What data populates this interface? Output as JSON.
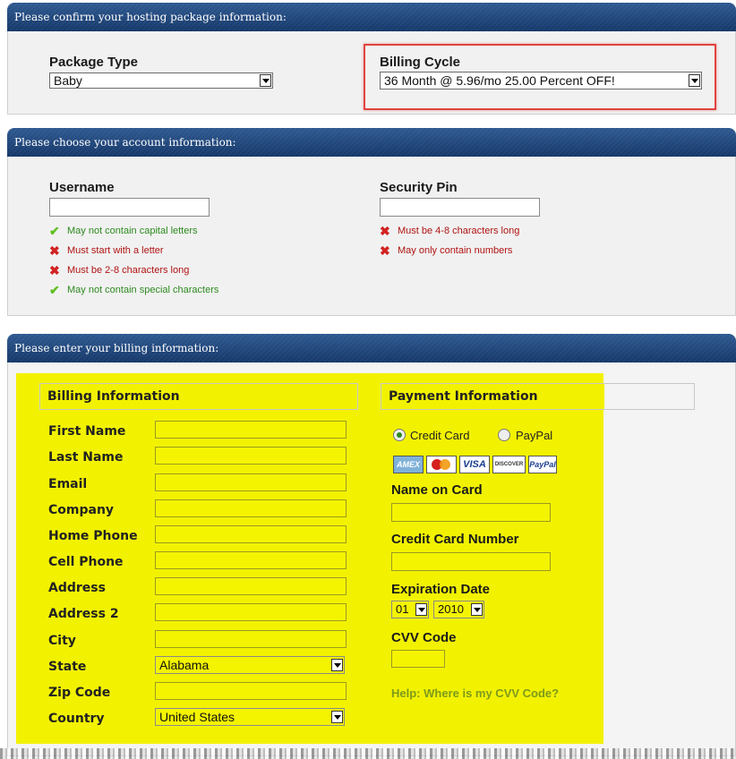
{
  "hosting": {
    "header": "Please confirm your hosting package information:",
    "package_type_label": "Package Type",
    "package_type_value": "Baby",
    "billing_cycle_label": "Billing Cycle",
    "billing_cycle_value": "36 Month @ 5.96/mo 25.00 Percent OFF!"
  },
  "account": {
    "header": "Please choose your account information:",
    "username_label": "Username",
    "username_rules": [
      {
        "text": "May not contain capital letters",
        "status": "ok"
      },
      {
        "text": "Must start with a letter",
        "status": "bad"
      },
      {
        "text": "Must be 2-8 characters long",
        "status": "bad"
      },
      {
        "text": "May not contain special characters",
        "status": "ok"
      }
    ],
    "pin_label": "Security Pin",
    "pin_rules": [
      {
        "text": "Must be 4-8 characters long",
        "status": "bad"
      },
      {
        "text": "May only contain numbers",
        "status": "bad"
      }
    ]
  },
  "billing": {
    "header": "Please enter your billing information:",
    "billing_info_title": "Billing Information",
    "payment_info_title": "Payment Information",
    "fields": {
      "first_name": "First Name",
      "last_name": "Last Name",
      "email": "Email",
      "company": "Company",
      "home_phone": "Home Phone",
      "cell_phone": "Cell Phone",
      "address": "Address",
      "address2": "Address 2",
      "city": "City",
      "state": "State",
      "zip": "Zip Code",
      "country": "Country"
    },
    "state_value": "Alabama",
    "country_value": "United States",
    "payment": {
      "credit_card_label": "Credit Card",
      "paypal_label": "PayPal",
      "cards": [
        "AMEX",
        "MC",
        "VISA",
        "DISCOVER",
        "PayPal"
      ],
      "name_on_card_label": "Name on Card",
      "cc_number_label": "Credit Card Number",
      "expiration_label": "Expiration Date",
      "exp_month": "01",
      "exp_year": "2010",
      "cvv_label": "CVV Code",
      "help_link": "Help: Where is my CVV Code?"
    }
  },
  "colors": {
    "header_bg": "#1f4479",
    "highlight_yellow": "#f2f200",
    "callout_red": "#e0443f",
    "rule_ok": "#2d8a1f",
    "rule_bad": "#b01313",
    "help_link": "#7e9a1b"
  }
}
